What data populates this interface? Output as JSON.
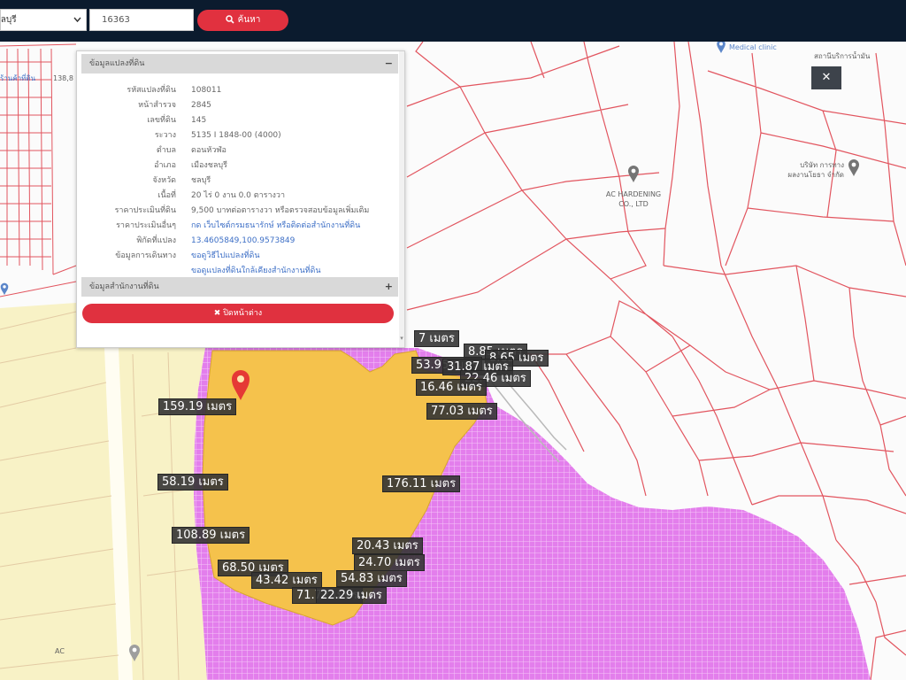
{
  "topbar": {
    "province": "ชลบุรี",
    "parcel_no": "16363",
    "search_label": "ค้นหา",
    "search_icon": "search-icon"
  },
  "popup": {
    "title": "ข้อมูลแปลงที่ดิน",
    "collapse_symbol": "−",
    "rows": [
      {
        "label": "รหัสแปลงที่ดิน",
        "value": "108011"
      },
      {
        "label": "หน้าสำรวจ",
        "value": "2845"
      },
      {
        "label": "เลขที่ดิน",
        "value": "145"
      },
      {
        "label": "ระวาง",
        "value": "5135 I 1848-00 (4000)"
      },
      {
        "label": "ตำบล",
        "value": "ดอนหัวฬ่อ"
      },
      {
        "label": "อำเภอ",
        "value": "เมืองชลบุรี"
      },
      {
        "label": "จังหวัด",
        "value": "ชลบุรี"
      },
      {
        "label": "เนื้อที่",
        "value": "20 ไร่ 0 งาน 0.0 ตารางวา"
      },
      {
        "label": "ราคาประเมินที่ดิน",
        "value": "9,500 บาทต่อตารางวา หรือตรวจสอบข้อมูลเพิ่มเติม"
      },
      {
        "label": "ราคาประเมินอื่นๆ",
        "value": "กด เว็บไซต์กรมธนารักษ์ หรือติดต่อสำนักงานที่ดิน"
      },
      {
        "label": "พิกัดที่แปลง",
        "value": "13.4605849,100.9573849"
      },
      {
        "label": "ข้อมูลการเดินทาง",
        "value": "ขอดูวิธีไปแปลงที่ดิน"
      },
      {
        "value": "ขอดูแปลงที่ดินใกล้เคียงสำนักงานที่ดิน"
      }
    ],
    "office_section_title": "ข้อมูลสำนักงานที่ดิน",
    "expand_symbol": "+",
    "close_label": "✖ ปิดหน้าต่าง"
  },
  "map": {
    "close_symbol": "✕",
    "distance_labels": [
      "7 เมตร",
      "8.85 เมตร",
      "8.65 เมตร",
      "53.95 เมตร",
      "31.87 เมตร",
      "22.46 เมตร",
      "16.46 เมตร",
      "77.03 เมตร",
      "159.19 เมตร",
      "58.19 เมตร",
      "176.11 เมตร",
      "108.89 เมตร",
      "20.43 เมตร",
      "24.70 เมตร",
      "68.50 เมตร",
      "43.42 เมตร",
      "54.83 เมตร",
      "71.72 เมตร",
      "22.29 เมตร"
    ],
    "pois": {
      "ac_line1": "AC HARDENING",
      "ac_line2": "CO., LTD",
      "company_line1": "บริษัท การทาง",
      "company_line2": "ผลงานโยธา จำกัด",
      "clinic": "Medical clinic",
      "fuel_station": "สถานีบริการน้ำมัน",
      "left_shop": "ร้านค้าที่ดิน",
      "left_number": "138,8",
      "bottom_left": "AC"
    }
  },
  "colors": {
    "topbar": "#0b1b2e",
    "accent": "#e1313f",
    "parcel_line": "#e2555f",
    "highlight_parcel": "#f5c24c",
    "zone_pink": "#e37eec",
    "zone_pale": "#f8f2c6",
    "link": "#3d6fc6"
  }
}
